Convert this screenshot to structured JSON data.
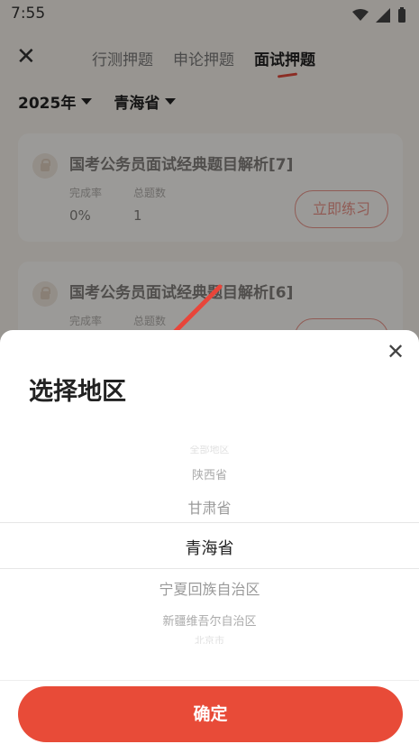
{
  "status": {
    "time": "7:55"
  },
  "header": {
    "tabs": [
      {
        "label": "行测押题"
      },
      {
        "label": "申论押题"
      },
      {
        "label": "面试押题"
      }
    ]
  },
  "filters": {
    "year": "2025年",
    "region": "青海省"
  },
  "cards": [
    {
      "title": "国考公务员面试经典题目解析[7]",
      "completion_label": "完成率",
      "completion_value": "0%",
      "total_label": "总题数",
      "total_value": "1",
      "button": "立即练习"
    },
    {
      "title": "国考公务员面试经典题目解析[6]",
      "completion_label": "完成率",
      "completion_value": "",
      "total_label": "总题数",
      "total_value": "",
      "button": ""
    }
  ],
  "sheet": {
    "title": "选择地区",
    "options": [
      "全部地区",
      "陕西省",
      "甘肃省",
      "青海省",
      "宁夏回族自治区",
      "新疆维吾尔自治区",
      "北京市"
    ],
    "selected": "青海省",
    "confirm": "确定"
  },
  "colors": {
    "accent": "#e84b38",
    "background": "#f6f1ea"
  }
}
